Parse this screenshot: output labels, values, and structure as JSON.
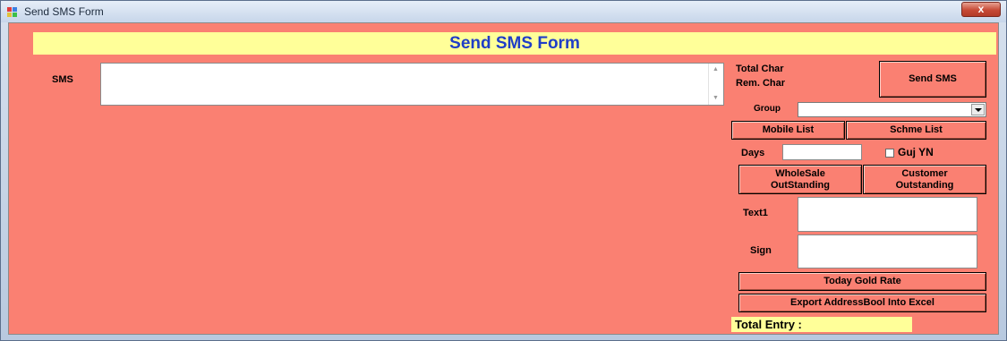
{
  "window": {
    "title": "Send SMS Form",
    "close_symbol": "x"
  },
  "header": {
    "title": "Send SMS Form"
  },
  "sms": {
    "label": "SMS",
    "value": ""
  },
  "counters": {
    "total_char_label": "Total Char",
    "rem_char_label": "Rem. Char"
  },
  "buttons": {
    "send_sms": "Send SMS",
    "mobile_list": "Mobile List",
    "schme_list": "Schme List",
    "wholesale_line1": "WholeSale",
    "wholesale_line2": "OutStanding",
    "customer_line1": "Customer",
    "customer_line2": "Outstanding",
    "today_gold_rate": "Today Gold Rate",
    "export": "Export AddressBool Into  Excel"
  },
  "group": {
    "label": "Group",
    "value": ""
  },
  "days": {
    "label": "Days",
    "value": ""
  },
  "guj": {
    "label": "Guj YN",
    "checked": false
  },
  "text1": {
    "label": "Text1",
    "value": ""
  },
  "sign": {
    "label": "Sign",
    "value": ""
  },
  "footer": {
    "total_entry_label": "Total Entry :"
  },
  "colors": {
    "form_bg": "#fa8072",
    "header_bg": "#ffff99",
    "header_text": "#1f3ec7"
  }
}
